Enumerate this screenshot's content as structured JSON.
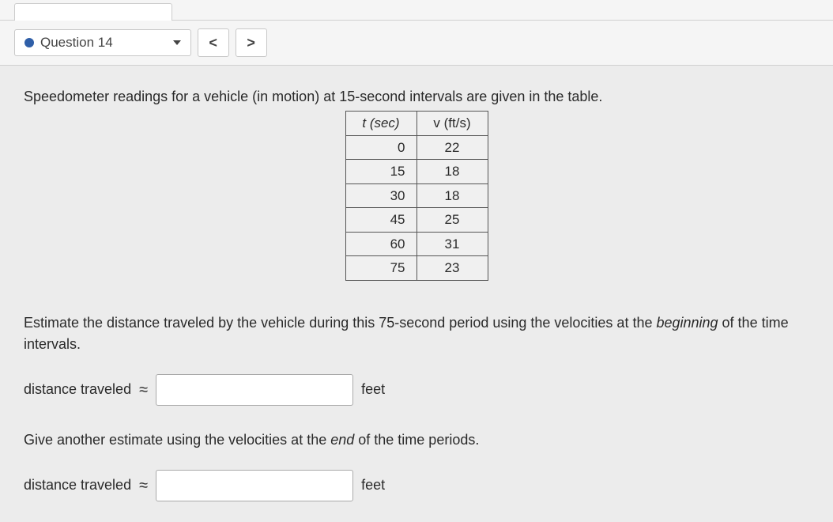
{
  "nav": {
    "question_label": "Question 14",
    "prev_glyph": "<",
    "next_glyph": ">"
  },
  "intro": "Speedometer readings for a vehicle (in motion) at 15-second intervals are given in the table.",
  "table": {
    "headers": {
      "t": "t (sec)",
      "v": "v (ft/s)"
    },
    "rows": [
      {
        "t": "0",
        "v": "22"
      },
      {
        "t": "15",
        "v": "18"
      },
      {
        "t": "30",
        "v": "18"
      },
      {
        "t": "45",
        "v": "25"
      },
      {
        "t": "60",
        "v": "31"
      },
      {
        "t": "75",
        "v": "23"
      }
    ]
  },
  "prompt1_a": "Estimate the distance traveled by the vehicle during this 75-second period using the velocities at the ",
  "prompt1_b": "beginning",
  "prompt1_c": " of the time intervals.",
  "prompt2_a": "Give another estimate using the velocities at the ",
  "prompt2_b": "end",
  "prompt2_c": " of the time periods.",
  "answer": {
    "label": "distance traveled",
    "approx": "≈",
    "unit": "feet"
  }
}
